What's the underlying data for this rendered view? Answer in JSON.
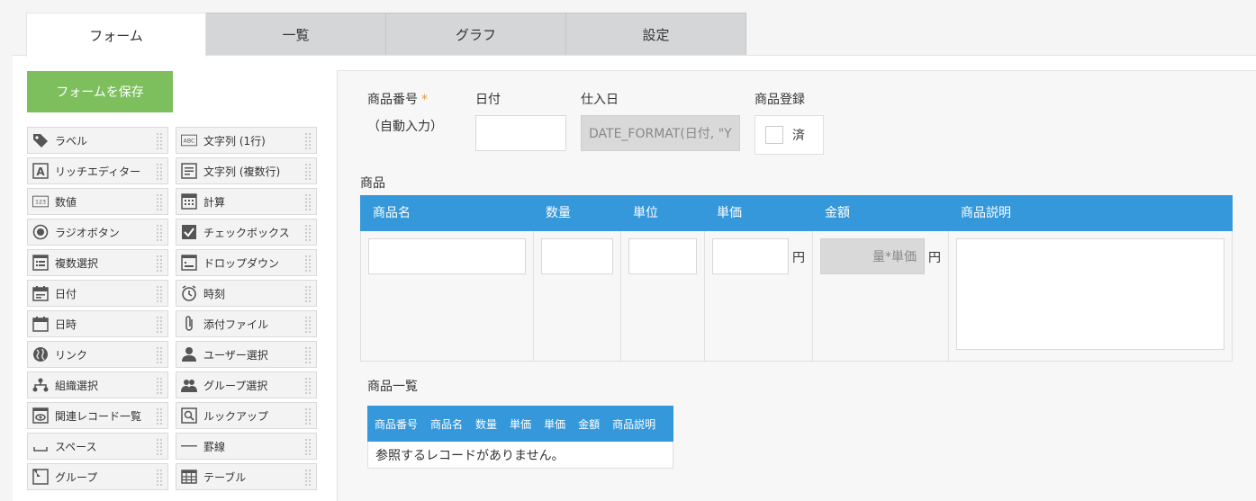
{
  "tabs": [
    {
      "label": "フォーム",
      "active": true
    },
    {
      "label": "一覧",
      "active": false
    },
    {
      "label": "グラフ",
      "active": false
    },
    {
      "label": "設定",
      "active": false
    }
  ],
  "save_button": "フォームを保存",
  "palette": [
    {
      "label": "ラベル",
      "icon": "tag-icon"
    },
    {
      "label": "文字列 (1行)",
      "icon": "abc-icon"
    },
    {
      "label": "リッチエディター",
      "icon": "rich-editor-icon"
    },
    {
      "label": "文字列 (複数行)",
      "icon": "multiline-text-icon"
    },
    {
      "label": "数値",
      "icon": "number-icon"
    },
    {
      "label": "計算",
      "icon": "calculator-icon"
    },
    {
      "label": "ラジオボタン",
      "icon": "radio-icon"
    },
    {
      "label": "チェックボックス",
      "icon": "checkbox-icon"
    },
    {
      "label": "複数選択",
      "icon": "multi-select-icon"
    },
    {
      "label": "ドロップダウン",
      "icon": "dropdown-icon"
    },
    {
      "label": "日付",
      "icon": "calendar-icon"
    },
    {
      "label": "時刻",
      "icon": "clock-icon"
    },
    {
      "label": "日時",
      "icon": "datetime-icon"
    },
    {
      "label": "添付ファイル",
      "icon": "paperclip-icon"
    },
    {
      "label": "リンク",
      "icon": "globe-icon"
    },
    {
      "label": "ユーザー選択",
      "icon": "user-icon"
    },
    {
      "label": "組織選択",
      "icon": "org-icon"
    },
    {
      "label": "グループ選択",
      "icon": "group-icon"
    },
    {
      "label": "関連レコード一覧",
      "icon": "related-records-icon"
    },
    {
      "label": "ルックアップ",
      "icon": "lookup-icon"
    },
    {
      "label": "スペース",
      "icon": "space-icon"
    },
    {
      "label": "罫線",
      "icon": "line-icon"
    },
    {
      "label": "グループ",
      "icon": "group-box-icon"
    },
    {
      "label": "テーブル",
      "icon": "table-icon"
    }
  ],
  "form": {
    "product_no_label": "商品番号",
    "required_mark": "*",
    "auto_input": "（自動入力）",
    "date_label": "日付",
    "purchase_date_label": "仕入日",
    "purchase_date_value": "DATE_FORMAT(日付, \"Y",
    "product_reg_label": "商品登録",
    "product_reg_check": "済",
    "products_label": "商品",
    "table_headers": [
      "商品名",
      "数量",
      "単位",
      "単価",
      "金額",
      "商品説明"
    ],
    "yen": "円",
    "amount_formula": "量*単価",
    "product_list_label": "商品一覧",
    "ref_headers": [
      "商品番号",
      "商品名",
      "数量",
      "単価",
      "単価",
      "金額",
      "商品説明"
    ],
    "ref_empty": "参照するレコードがありません。"
  }
}
